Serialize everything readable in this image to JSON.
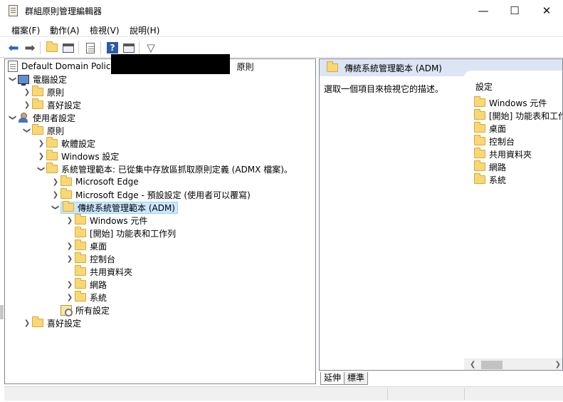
{
  "window": {
    "title": "群組原則管理編輯器",
    "controls": {
      "minimize": "—",
      "maximize": "☐",
      "close": "✕"
    }
  },
  "menu": [
    "檔案(F)",
    "動作(A)",
    "檢視(V)",
    "說明(H)"
  ],
  "toolbar": {
    "icons": [
      "back-arrow",
      "forward-arrow",
      "up-folder",
      "show-hide-tree",
      "export-list",
      "help",
      "properties",
      "filter"
    ]
  },
  "tree": {
    "root": "Default Domain Policy",
    "root_suffix": "原則",
    "computer_config": "電腦設定",
    "computer_policies": "原則",
    "computer_preferences": "喜好設定",
    "user_config": "使用者設定",
    "user_policies": "原則",
    "software_settings": "軟體設定",
    "windows_settings": "Windows 設定",
    "admin_templates": "系統管理範本: 已從集中存放區抓取原則定義 (ADMX 檔案)。",
    "edge": "Microsoft Edge",
    "edge_default": "Microsoft Edge - 預設設定 (使用者可以覆寫)",
    "classic_templates": "傳統系統管理範本 (ADM)",
    "windows_components": "Windows 元件",
    "start_menu": "[開始] 功能表和工作列",
    "desktop": "桌面",
    "control_panel": "控制台",
    "shared_folders": "共用資料夾",
    "network": "網路",
    "system": "系統",
    "all_settings": "所有設定",
    "user_preferences": "喜好設定"
  },
  "right": {
    "header": "傳統系統管理範本 (ADM)",
    "description": "選取一個項目來檢視它的描述。",
    "column_header": "設定",
    "items": [
      "Windows 元件",
      "[開始] 功能表和工作",
      "桌面",
      "控制台",
      "共用資料夾",
      "網路",
      "系統"
    ]
  },
  "tabs": [
    "延伸",
    "標準"
  ],
  "colors": {
    "selection": "#cce8ff",
    "header_bg": "#dbe5f3",
    "folder": "#f8d775"
  }
}
